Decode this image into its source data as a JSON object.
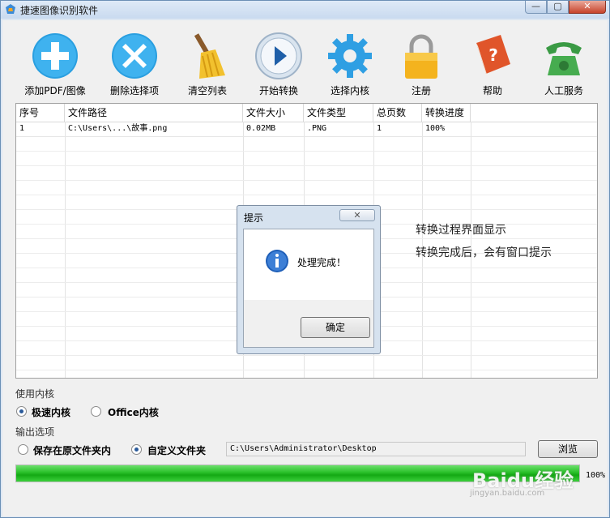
{
  "window": {
    "title": "捷速图像识别软件",
    "min_label": "—",
    "max_label": "▢",
    "close_label": "✕"
  },
  "toolbar": {
    "items": [
      {
        "label": "添加PDF/图像",
        "icon": "add-icon"
      },
      {
        "label": "删除选择项",
        "icon": "delete-icon"
      },
      {
        "label": "清空列表",
        "icon": "broom-icon"
      },
      {
        "label": "开始转换",
        "icon": "play-icon"
      },
      {
        "label": "选择内核",
        "icon": "gear-icon"
      },
      {
        "label": "注册",
        "icon": "lock-icon"
      },
      {
        "label": "帮助",
        "icon": "help-book-icon"
      },
      {
        "label": "人工服务",
        "icon": "phone-icon"
      }
    ]
  },
  "table": {
    "columns": [
      "序号",
      "文件路径",
      "文件大小",
      "文件类型",
      "总页数",
      "转换进度"
    ],
    "rows": [
      {
        "index": "1",
        "path": "C:\\Users\\...\\故事.png",
        "size": "0.02MB",
        "type": ".PNG",
        "pages": "1",
        "progress": "100%"
      }
    ]
  },
  "annotation": {
    "line1": "转换过程界面显示",
    "line2": "转换完成后，会有窗口提示"
  },
  "dialog": {
    "title": "提示",
    "close_label": "✕",
    "message": "处理完成！",
    "ok_label": "确定",
    "icon": "info-icon"
  },
  "kernel": {
    "label": "使用内核",
    "options": [
      "极速内核",
      "Office内核"
    ],
    "selected": 0
  },
  "output": {
    "label": "输出选项",
    "options": [
      "保存在原文件夹内",
      "自定义文件夹"
    ],
    "selected": 1,
    "path": "C:\\Users\\Administrator\\Desktop",
    "browse_label": "浏览"
  },
  "progress": {
    "value": 1.0,
    "label": "100%"
  },
  "watermark": {
    "text": "Baidu经验",
    "sub": "jingyan.baidu.com"
  },
  "colors": {
    "progress_green": "#13a813",
    "window_frame": "#dde7f2",
    "close_red": "#c7432b"
  }
}
